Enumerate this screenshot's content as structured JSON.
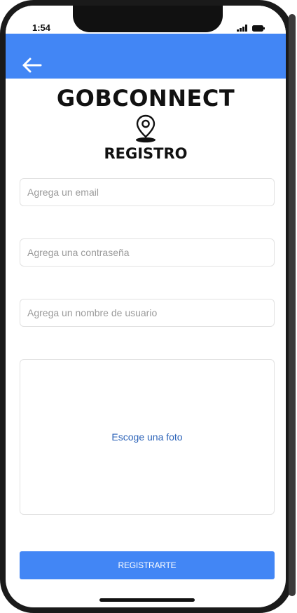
{
  "status_bar": {
    "time": "1:54",
    "signal_icon": "cellular-signal-icon",
    "battery_icon": "battery-icon"
  },
  "header": {
    "back_icon": "arrow-left-icon",
    "color": "#4286f5"
  },
  "branding": {
    "app_name": "GOBCONNECT",
    "logo_icon": "map-pin-icon"
  },
  "page": {
    "title": "REGISTRO"
  },
  "form": {
    "email_placeholder": "Agrega un email",
    "password_placeholder": "Agrega una contraseña",
    "username_placeholder": "Agrega un nombre de usuario",
    "photo_label": "Escoge una foto",
    "submit_label": "REGISTRARTE"
  },
  "colors": {
    "accent": "#4286f5",
    "link": "#2c63b8",
    "border": "#e2e2e2"
  }
}
